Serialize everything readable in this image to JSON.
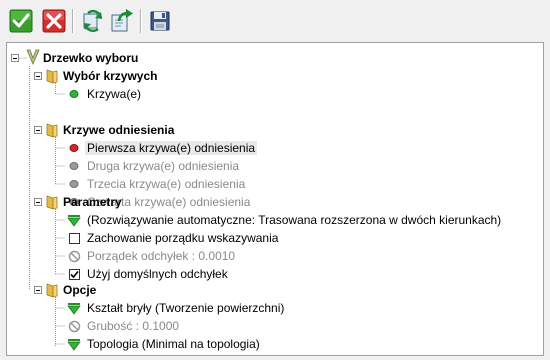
{
  "toolbar": {
    "buttons": [
      {
        "name": "ok-button",
        "icon": "green-checkmark-icon"
      },
      {
        "name": "cancel-button",
        "icon": "red-x-icon"
      },
      {
        "name": "swap-button",
        "icon": "refresh-arrows-icon"
      },
      {
        "name": "export-button",
        "icon": "export-arrow-icon"
      },
      {
        "name": "save-button",
        "icon": "floppy-disk-icon"
      }
    ]
  },
  "tree": {
    "root": {
      "label": "Drzewko wyboru",
      "icon": "v-root-icon"
    },
    "wybor": {
      "label": "Wybór krzywych",
      "items": [
        {
          "label": "Krzywa(e)",
          "status": "green"
        }
      ]
    },
    "krzywe": {
      "label": "Krzywe odniesienia",
      "items": [
        {
          "label": "Pierwsza krzywa(e) odniesienia",
          "status": "red",
          "selected": true
        },
        {
          "label": "Druga krzywa(e) odniesienia",
          "status": "gray",
          "disabled": true
        },
        {
          "label": "Trzecia krzywa(e) odniesienia",
          "status": "gray",
          "disabled": true
        },
        {
          "label": "Czwarta krzywa(e) odniesienia",
          "status": "gray",
          "disabled": true
        }
      ]
    },
    "parametry": {
      "label": "Parametry",
      "items": [
        {
          "label": "(Rozwiązywanie automatyczne: Trasowana rozszerzona w dwóch kierunkach)",
          "type": "dropdown"
        },
        {
          "label": "Zachowanie porządku wskazywania",
          "type": "checkbox",
          "checked": false
        },
        {
          "label": "Porządek odchyłek : 0.0010",
          "type": "disabled"
        },
        {
          "label": "Użyj domyślnych odchyłek",
          "type": "checkbox",
          "checked": true
        }
      ]
    },
    "opcje": {
      "label": "Opcje",
      "items": [
        {
          "label": "Kształt bryły (Tworzenie powierzchni)",
          "type": "dropdown"
        },
        {
          "label": "Grubość : 0.1000",
          "type": "disabled"
        },
        {
          "label": "Topologia (Minimal na topologia)",
          "type": "dropdown"
        }
      ]
    }
  },
  "colors": {
    "status_green": "#2fb43a",
    "status_red": "#d6262b",
    "status_gray": "#9a9a9a",
    "folder": "#e3b94a",
    "disabled_text": "#8a8a8a"
  }
}
